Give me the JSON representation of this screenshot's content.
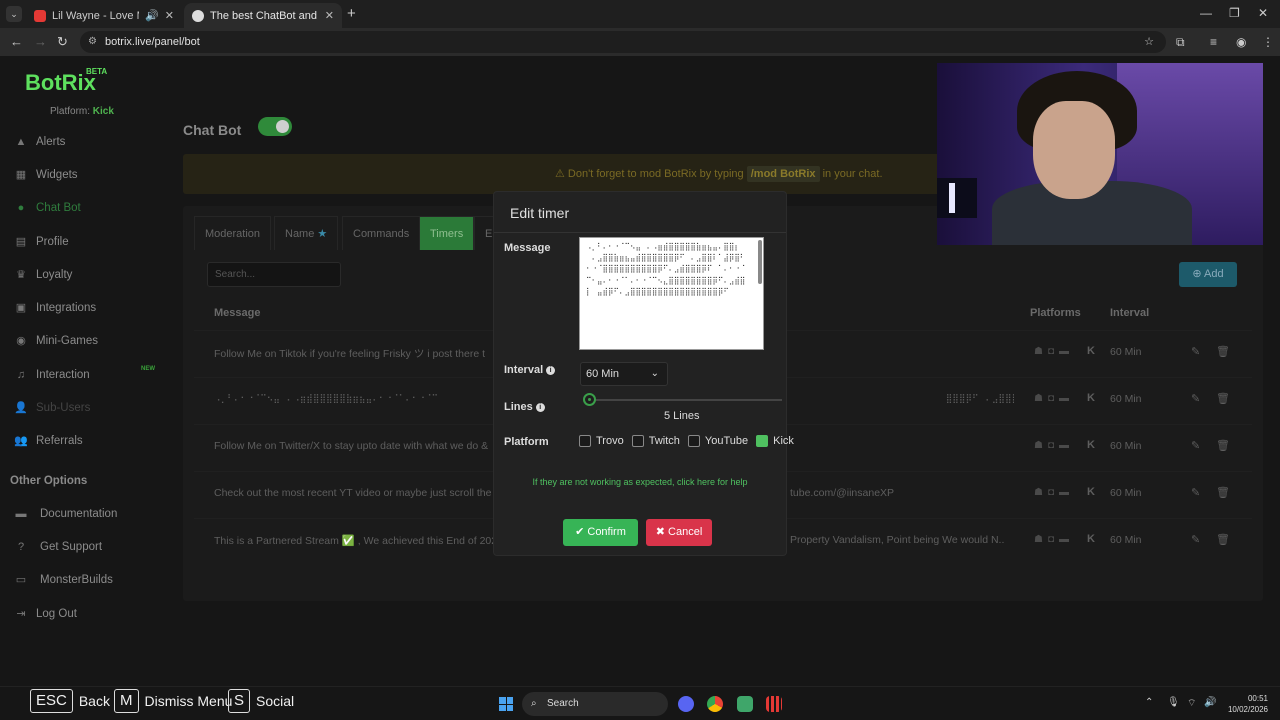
{
  "browser": {
    "tabs": [
      {
        "title": "Lil Wayne - Love Me (Explic",
        "active": false
      },
      {
        "title": "The best ChatBot and Widgets",
        "active": true
      }
    ],
    "url": "botrix.live/panel/bot"
  },
  "sidebar": {
    "logo": "BotRix",
    "beta": "BETA",
    "platform_label": "Platform:",
    "platform_value": "Kick",
    "items": [
      {
        "label": "Alerts",
        "icon": "warning-icon"
      },
      {
        "label": "Widgets",
        "icon": "grid-icon"
      },
      {
        "label": "Chat Bot",
        "icon": "robot-icon"
      },
      {
        "label": "Profile",
        "icon": "id-card-icon"
      },
      {
        "label": "Loyalty",
        "icon": "trophy-icon"
      },
      {
        "label": "Integrations",
        "icon": "plug-icon"
      },
      {
        "label": "Mini-Games",
        "icon": "gamepad-icon"
      },
      {
        "label": "Interaction",
        "icon": "music-icon"
      },
      {
        "label": "Sub-Users",
        "icon": "users-icon"
      },
      {
        "label": "Referrals",
        "icon": "people-icon"
      }
    ],
    "new_badge": "NEW",
    "other_options": "Other Options",
    "other_items": [
      {
        "label": "Documentation",
        "icon": "book-icon"
      },
      {
        "label": "Get Support",
        "icon": "help-icon"
      },
      {
        "label": "MonsterBuilds",
        "icon": "monitor-icon"
      },
      {
        "label": "Log Out",
        "icon": "logout-icon"
      }
    ]
  },
  "main": {
    "title": "Chat Bot",
    "banner_pre": "Don't forget to mod BotRix by typing",
    "banner_code": "/mod BotRix",
    "banner_post": "in your chat.",
    "tabs": [
      "Moderation",
      "Name",
      "Commands",
      "Timers",
      "E"
    ],
    "search_placeholder": "Search...",
    "add_label": "Add",
    "columns": {
      "message": "Message",
      "platforms": "Platforms",
      "interval": "Interval"
    },
    "rows": [
      {
        "message": "Follow Me on Tiktok if you're feeling Frisky ツ i post there t",
        "interval": "60 Min"
      },
      {
        "message": "⠠⡀⠃⠄⠂⠐⠈⠉⠢⣤⠀⠄⠠⣶⣾⣿⣿⣿⣿⣿⣷⣶⣦⣤⠄⠂⠐⠈⠁⠄⠂⠐⠈⠉⠀⠀⠀⠀⠀⠀⠀⠀⠀⠀⠀⠀⠀⠀⠀⠀⠀⠀⠀⠀⠀⠀⠀⠀⠀⠀⠀⠀⠀⠀⠀⠀⠀⠀⠀⠀⠀⠀⠀⠀⠀⠀⠀⠀⠀⠀⠀⠀⠀⠀⠀⠀⠀⠀⠀⠀⠀⠀⠀⠀⠀⠀⠀⠀⠀⠀⠀⠀⠀⠀⠀⠀⠀⠀⠀⠀⠀⣿⣿⣿⡿⠋⠀⠄⣠⣿⣿⣿⣿⣿⡿⠋⠄⠂⠐⠈⠁⠄⠂⠐⠈⠉⠢⣄⠀",
        "interval": "60 Min"
      },
      {
        "message": "Follow Me on Twitter/X to stay upto date with what we do &",
        "interval": "60 Min"
      },
      {
        "message": "Check out the most recent YT video or maybe just scroll the",
        "message_tail": "tube.com/@iinsaneXP",
        "interval": "60 Min"
      },
      {
        "message": "This is a Partnered Stream ✅ , We achieved this End of 202",
        "message_tail": "Property Vandalism, Point being We would N...",
        "interval": "60 Min"
      }
    ]
  },
  "modal": {
    "title": "Edit timer",
    "message_label": "Message",
    "message_value": "⠠⡀⠃⠄⠂⠐⠈⠉⠢⣤⠀⠄⠠⣶⣾⣿⣿⣿⣿⣿⣷⣶⣦⣤⠄⣿⣿⡆⠀⠀⠄⣠⣿⣿⣷⣶⣦⣤⣾⣿⣿⣿⣿⣿⣿⡿⠋⠀⠄⣠⣿⣿⠇⠁⣼⡿⣿⠃⠂⠐⠈⣿⣿⣿⣿⣿⣿⣿⣿⣿⣿⡿⠋⠄⣠⣾⣿⣿⣿⡿⠏⠀⠁⠄⠂⠐⠈⠉⠂⣤⠄⠂⠐⠈⠁⠄⠂⠐⠈⠉⠢⣄⣿⣿⣿⣿⣿⣿⣿⣿⡿⠋⠄⣠⣾⣿⡇⠀⣤⣾⡿⠋⠄⣠⣿⣿⣿⣿⣿⣿⣿⣿⣿⣿⣿⣿⣿⣿⣿⣿⡿⠋",
    "interval_label": "Interval",
    "interval_value": "60 Min",
    "lines_label": "Lines",
    "lines_value": "5 Lines",
    "platform_label": "Platform",
    "platforms": [
      {
        "name": "Trovo",
        "checked": false
      },
      {
        "name": "Twitch",
        "checked": false
      },
      {
        "name": "YouTube",
        "checked": false
      },
      {
        "name": "Kick",
        "checked": true
      }
    ],
    "help_text": "If they are not working as expected, click here for help",
    "confirm_label": "Confirm",
    "cancel_label": "Cancel"
  },
  "overlay_keys": [
    {
      "key": "ESC",
      "label": "Back"
    },
    {
      "key": "M",
      "label": "Dismiss Menu"
    },
    {
      "key": "S",
      "label": "Social"
    }
  ],
  "taskbar": {
    "search_label": "Search",
    "time": "00:51",
    "date": "10/02/2026"
  }
}
